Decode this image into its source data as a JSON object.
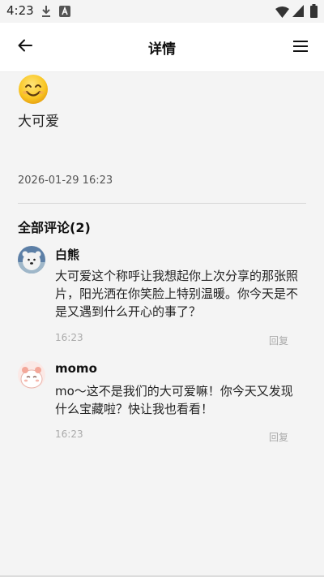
{
  "status_bar": {
    "time": "4:23"
  },
  "header": {
    "title": "详情",
    "back_icon": "arrow-left-icon",
    "menu_icon": "hamburger-menu-icon"
  },
  "post": {
    "emoji": "smiling-face-icon",
    "text": "大可爱",
    "date": "2026-01-29 16:23"
  },
  "comments_section": {
    "heading": "全部评论(2)",
    "comments": [
      {
        "author": "白熊",
        "body": "大可爱这个称呼让我想起你上次分享的那张照片，阳光洒在你笑脸上特别温暖。你今天是不是又遇到什么开心的事了？",
        "time": "16:23",
        "reply_label": "回复"
      },
      {
        "author": "momo",
        "body": "mo～这不是我们的大可爱嘛！你今天又发现什么宝藏啦？快让我也看看！",
        "time": "16:23",
        "reply_label": "回复"
      }
    ]
  },
  "colors": {
    "background": "#f4f4f4",
    "header_background": "#ffffff",
    "muted_text": "#aaaaaa",
    "divider": "#d6d6d6"
  }
}
